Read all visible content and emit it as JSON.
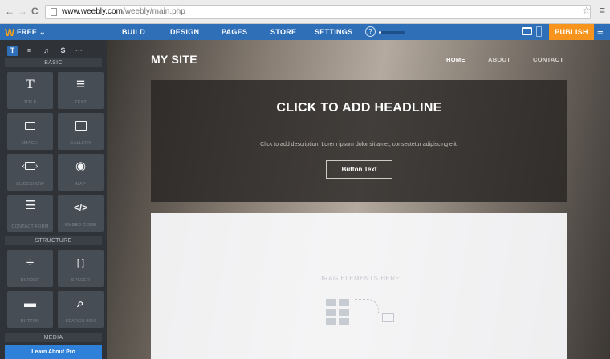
{
  "browser": {
    "back": "←",
    "forward": "→",
    "reload": "C",
    "url_host": "www.weebly.com",
    "url_path": "/weebly/main.php",
    "star": "☆",
    "menu": "≡"
  },
  "topbar": {
    "logo": "W",
    "plan": "FREE ⌄",
    "nav": [
      "BUILD",
      "DESIGN",
      "PAGES",
      "STORE",
      "SETTINGS"
    ],
    "help": "?",
    "publish": "PUBLISH",
    "menu": "≡",
    "accent_color": "#2e6fb7",
    "publish_color": "#f7941d"
  },
  "sidebar": {
    "tabs": [
      "T",
      "≡",
      "♫",
      "S",
      "···"
    ],
    "sections": [
      "BASIC",
      "STRUCTURE",
      "MEDIA"
    ],
    "basic": [
      {
        "icon": "T",
        "label": "TITLE",
        "name": "title-icon"
      },
      {
        "icon": "≡",
        "label": "TEXT",
        "name": "text-icon"
      },
      {
        "icon": "",
        "label": "IMAGE",
        "name": "image-icon"
      },
      {
        "icon": "",
        "label": "GALLERY",
        "name": "gallery-icon"
      },
      {
        "icon": "",
        "label": "SLIDESHOW",
        "name": "slideshow-icon"
      },
      {
        "icon": "◉",
        "label": "MAP",
        "name": "map-icon"
      },
      {
        "icon": "☰",
        "label": "CONTACT FORM",
        "name": "contact-form-icon"
      },
      {
        "icon": "</>",
        "label": "EMBED CODE",
        "name": "embed-code-icon"
      }
    ],
    "structure": [
      {
        "icon": "÷",
        "label": "DIVIDER",
        "name": "divider-icon"
      },
      {
        "icon": "[ ]",
        "label": "SPACER",
        "name": "spacer-icon"
      },
      {
        "icon": "▬",
        "label": "BUTTON",
        "name": "button-icon"
      },
      {
        "icon": "⌕",
        "label": "SEARCH BOX",
        "name": "search-box-icon"
      }
    ],
    "learn_pro": "Learn About Pro"
  },
  "site": {
    "title": "MY SITE",
    "nav": [
      "HOME",
      "ABOUT",
      "CONTACT"
    ],
    "headline": "CLICK TO ADD HEADLINE",
    "description": "Click to add description. Lorem ipsum dolor sit amet, consectetur adipiscing elit.",
    "button_text": "Button Text",
    "drop_text": "DRAG ELEMENTS HERE"
  },
  "progress_fraction": 0.1
}
